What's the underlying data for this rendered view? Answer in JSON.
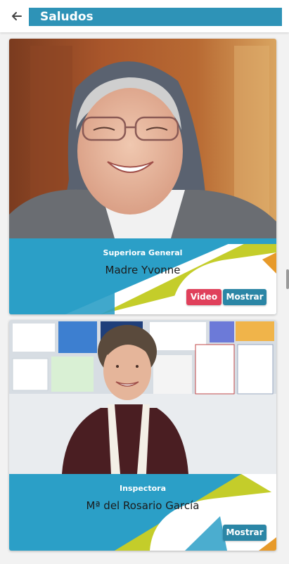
{
  "header": {
    "title": "Saludos",
    "back_icon": "arrow-left-icon"
  },
  "colors": {
    "accent_blue": "#2e93b7",
    "lime": "#c4cd2a",
    "orange": "#e79a2a",
    "video_red": "#e0405b",
    "button_blue": "#2b86a6"
  },
  "cards": [
    {
      "role": "Superiora General",
      "name": "Madre Yvonne",
      "video_label": "Video",
      "show_label": "Mostrar"
    },
    {
      "role": "Inspectora",
      "name": "Mª del Rosario García",
      "show_label": "Mostrar"
    }
  ]
}
